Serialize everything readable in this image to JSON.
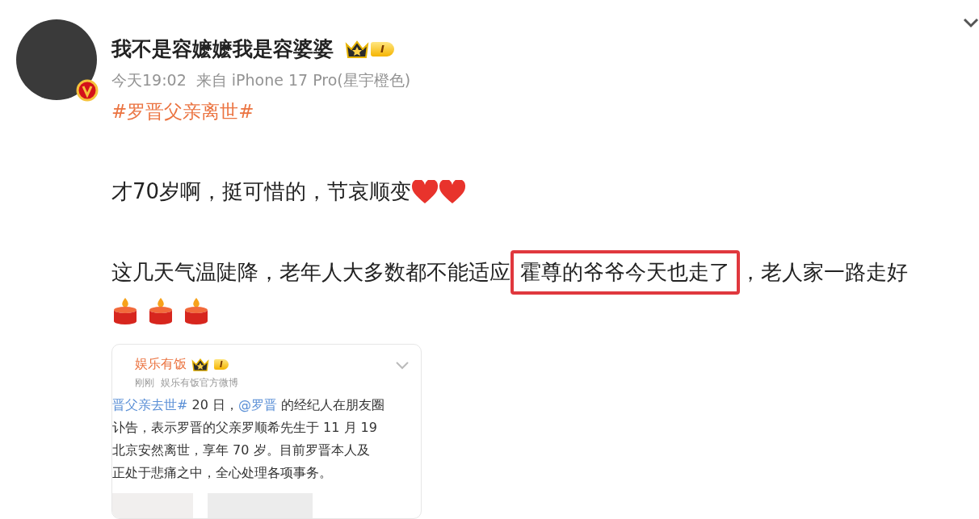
{
  "post": {
    "author": "我不是容嬷嬷我是容婆婆",
    "level_badge": "I",
    "time": "今天19:02",
    "source": "来自 iPhone 17 Pro(星宇橙色)",
    "hashtag": "#罗晋父亲离世#"
  },
  "paragraphs": [
    {
      "segments": [
        {
          "kind": "text",
          "text": "才70岁啊，挺可惜的，节哀顺变"
        },
        {
          "kind": "heart"
        },
        {
          "kind": "heart"
        }
      ]
    },
    {
      "segments": [
        {
          "kind": "text",
          "text": "这几天气温陡降，老年人大多数都不能适应"
        },
        {
          "kind": "highlight",
          "text": "霍尊的爷爷今天也走了"
        },
        {
          "kind": "text",
          "text": "，老人家一路走好"
        }
      ]
    },
    {
      "segments": [
        {
          "kind": "candle"
        },
        {
          "kind": "candle"
        },
        {
          "kind": "candle"
        }
      ]
    }
  ],
  "embedded": {
    "author": "娱乐有饭",
    "level_badge": "I",
    "time": "刚刚",
    "source": "娱乐有饭官方微博",
    "lines": [
      [
        {
          "kind": "link",
          "text": "晋父亲去世#"
        },
        {
          "kind": "text",
          "text": " 20 日，"
        },
        {
          "kind": "link",
          "text": "@罗晋"
        },
        {
          "kind": "text",
          "text": " 的经纪人在朋友圈"
        }
      ],
      [
        {
          "kind": "text",
          "text": "讣告，表示罗晋的父亲罗顺希先生于 11 月 19"
        }
      ],
      [
        {
          "kind": "text",
          "text": "北京安然离世，享年 70 岁。目前罗晋本人及"
        }
      ],
      [
        {
          "kind": "text",
          "text": "正处于悲痛之中，全心处理各项事务。"
        }
      ]
    ]
  }
}
